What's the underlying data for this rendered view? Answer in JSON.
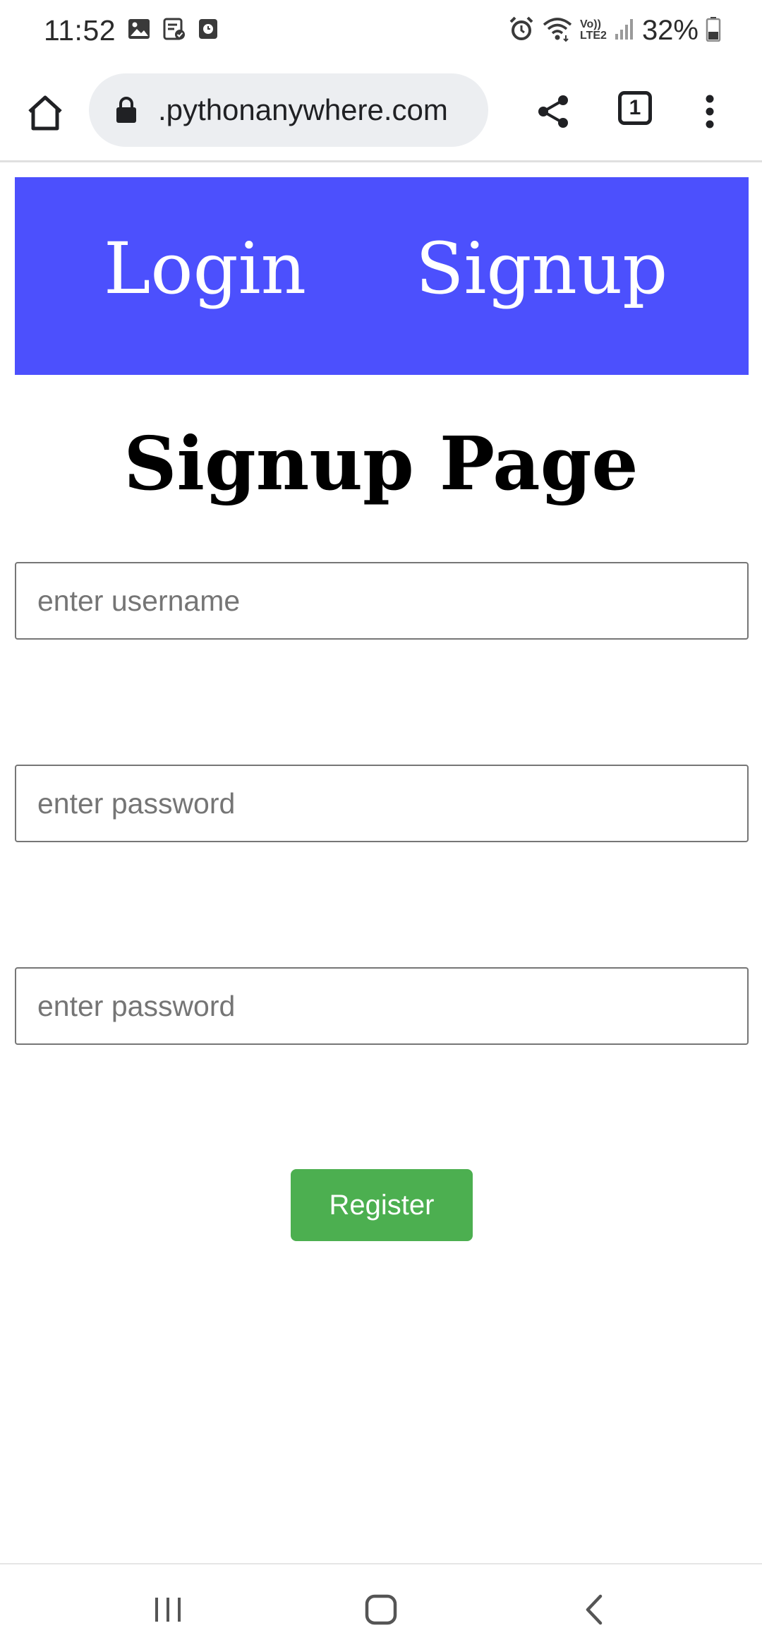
{
  "status_bar": {
    "time": "11:52",
    "battery": "32%",
    "left_icons": [
      "gallery-icon",
      "task-check-icon",
      "clock-app-icon"
    ],
    "right_icons": [
      "alarm-icon",
      "wifi-icon",
      "volte-lte2-icon",
      "signal-icon",
      "battery-icon"
    ],
    "volte_label": "Vo))",
    "lte_label": "LTE2"
  },
  "browser": {
    "url": ".pythonanywhere.com",
    "tab_count": "1"
  },
  "nav": {
    "login": "Login",
    "signup": "Signup",
    "background_color": "#4c50fd"
  },
  "page": {
    "title": "Signup Page"
  },
  "form": {
    "username_placeholder": "enter username",
    "password_placeholder": "enter password",
    "confirm_placeholder": "enter password",
    "register_label": "Register",
    "register_color": "#4caf50"
  }
}
